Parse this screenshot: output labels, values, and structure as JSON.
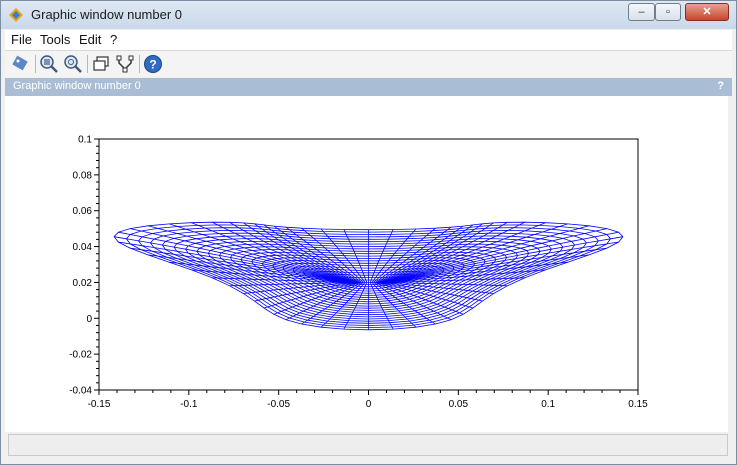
{
  "window": {
    "title": "Graphic window number 0",
    "controls": {
      "minimize": "–",
      "maximize": "▫",
      "close": "✕"
    }
  },
  "menu": {
    "items": [
      "File",
      "Tools",
      "Edit",
      "?"
    ]
  },
  "toolbar": {
    "buttons": [
      {
        "icon": "pointer-icon",
        "accent": "#3a6fb0"
      },
      {
        "icon": "zoom-icon"
      },
      {
        "icon": "unzoom-icon"
      },
      {
        "icon": "rotate-window-icon"
      },
      {
        "icon": "datatip-icon"
      },
      {
        "icon": "help-icon"
      }
    ]
  },
  "infobar": {
    "text": "Graphic window number 0",
    "help": "?"
  },
  "colors": {
    "mesh": "#0000ff",
    "infobar": "#a9bdd4"
  },
  "chart_data": {
    "type": "line",
    "description": "3D-projected wireframe mesh surface",
    "xlim": [
      -0.15,
      0.15
    ],
    "ylim": [
      -0.04,
      0.1
    ],
    "xticks": [
      "-0.15",
      "-0.1",
      "-0.05",
      "0",
      "0.05",
      "0.1",
      "0.15"
    ],
    "yticks": [
      "-0.04",
      "-0.02",
      "0",
      "0.02",
      "0.04",
      "0.06",
      "0.08",
      "0.1"
    ],
    "series": [
      {
        "values": []
      }
    ],
    "grid": false,
    "xlabel": "",
    "ylabel": "",
    "title": ""
  }
}
